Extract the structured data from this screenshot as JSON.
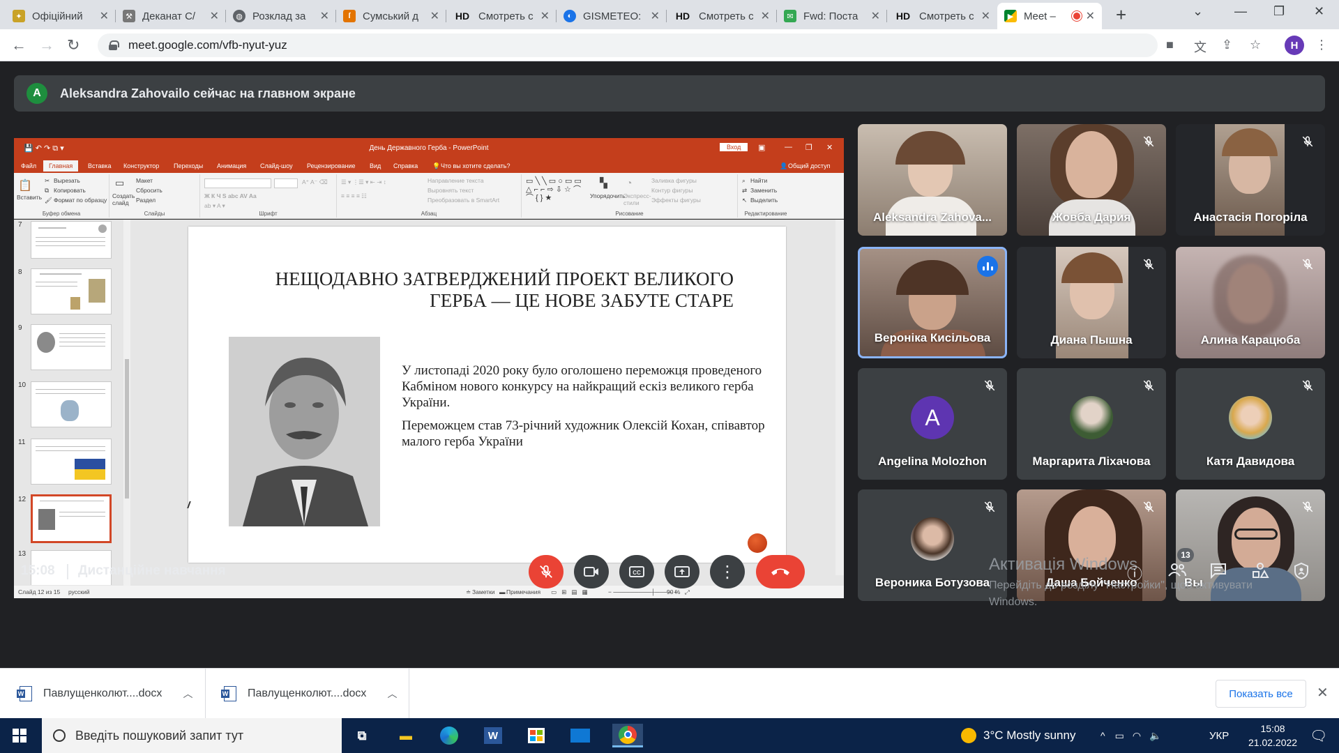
{
  "browser": {
    "tabs": [
      {
        "label": "Офіційний",
        "icon": "coat-of-arms-icon"
      },
      {
        "label": "Деканат С/",
        "icon": "tool-icon"
      },
      {
        "label": "Розклад за",
        "icon": "globe-icon"
      },
      {
        "label": "Сумський д",
        "icon": "university-icon"
      },
      {
        "label": "Смотреть с",
        "icon": "hd-icon"
      },
      {
        "label": "GISMETEO:",
        "icon": "gismeteo-icon"
      },
      {
        "label": "Смотреть с",
        "icon": "hd-icon"
      },
      {
        "label": "Fwd: Поста",
        "icon": "mail-icon"
      },
      {
        "label": "Смотреть с",
        "icon": "hd-icon"
      },
      {
        "label": "Meet –",
        "icon": "meet-icon"
      }
    ],
    "url": "meet.google.com/vfb-nyut-yuz",
    "profile_initial": "H"
  },
  "meet": {
    "presenter_initial": "A",
    "presenter_banner": "Aleksandra Zahovailo сейчас на главном экране",
    "time": "15:08",
    "meeting_name": "Дистанційне навчання",
    "participants_count": "13",
    "participants": [
      {
        "name": "Aleksandra Zahova...",
        "type": "video",
        "muted": false
      },
      {
        "name": "Жовба Дария",
        "type": "video",
        "muted": true
      },
      {
        "name": "Анастасія Погоріла",
        "type": "video",
        "muted": true
      },
      {
        "name": "Вероніка Кисільова",
        "type": "video",
        "muted": false,
        "speaking": true
      },
      {
        "name": "Диана Пышна",
        "type": "video",
        "muted": true
      },
      {
        "name": "Алина Карацюба",
        "type": "video",
        "muted": true
      },
      {
        "name": "Angelina Molozhon",
        "type": "avatar",
        "initial": "A",
        "muted": true
      },
      {
        "name": "Маргарита Ліхачова",
        "type": "avatar",
        "muted": true
      },
      {
        "name": "Катя Давидова",
        "type": "avatar",
        "muted": true
      },
      {
        "name": "Вероника Ботузова",
        "type": "avatar",
        "muted": true
      },
      {
        "name": "Даша Бойченко",
        "type": "video",
        "muted": true
      },
      {
        "name": "Вы",
        "type": "video",
        "muted": true
      }
    ]
  },
  "powerpoint": {
    "title": "День Державного Герба - PowerPoint",
    "login": "Вход",
    "share": "Общий доступ",
    "tabs": [
      "Файл",
      "Главная",
      "Вставка",
      "Конструктор",
      "Переходы",
      "Анимация",
      "Слайд-шоу",
      "Рецензирование",
      "Вид",
      "Справка",
      "Что вы хотите сделать?"
    ],
    "ribbon": {
      "clipboard": {
        "label": "Буфер обмена",
        "paste": "Вставить",
        "cut": "Вырезать",
        "copy": "Копировать",
        "format": "Формат по образцу"
      },
      "slides": {
        "label": "Слайды",
        "new_slide": "Создать слайд",
        "layout": "Макет",
        "reset": "Сбросить",
        "section": "Раздел"
      },
      "font": {
        "label": "Шрифт"
      },
      "paragraph": {
        "label": "Абзац",
        "text_direction": "Направление текста",
        "align_text": "Выровнять текст",
        "smartart": "Преобразовать в SmartArt"
      },
      "drawing": {
        "label": "Рисование",
        "arrange": "Упорядочить",
        "quick_styles": "Экспресс-стили",
        "fill": "Заливка фигуры",
        "outline": "Контур фигуры",
        "effects": "Эффекты фигуры"
      },
      "editing": {
        "label": "Редактирование",
        "find": "Найти",
        "replace": "Заменить",
        "select": "Выделить"
      }
    },
    "thumbnail_numbers": [
      "7",
      "8",
      "9",
      "10",
      "11",
      "12",
      "13"
    ],
    "selected_slide": "12",
    "slide": {
      "title_line1": "НЕЩОДАВНО ЗАТВЕРДЖЕНИЙ ПРОЕКТ ВЕЛИКОГО",
      "title_line2": "ГЕРБА — ЦЕ НОВЕ ЗАБУТЕ СТАРЕ",
      "para1": " У листопаді 2020 року було оголошено переможця проведеного Кабміном нового конкурсу на найкращий ескіз великого герба України.",
      "para2": " Переможцем став 73-річний художник Олексій Кохан, співавтор малого герба України"
    },
    "status": {
      "slide_info": "Слайд 12 из 15",
      "language": "русский",
      "notes": "Заметки",
      "comments": "Примечания",
      "zoom": "90 %"
    }
  },
  "activation": {
    "title": "Активація Windows",
    "text": "Перейдіть до розділу \"Настройки\", щоб активувати Windows."
  },
  "downloads": {
    "items": [
      "Павлущенколют....docx",
      "Павлущенколют....docx"
    ],
    "show_all": "Показать все"
  },
  "taskbar": {
    "search_placeholder": "Введіть пошуковий запит тут",
    "weather": "3°C  Mostly sunny",
    "language": "УКР",
    "time": "15:08",
    "date": "21.02.2022"
  },
  "colors": {
    "meet_bg": "#202124",
    "tile_bg": "#3c4043",
    "hangup_red": "#ea4335",
    "powerpoint_accent": "#c43e1c",
    "active_speaker": "#8ab4f8"
  }
}
